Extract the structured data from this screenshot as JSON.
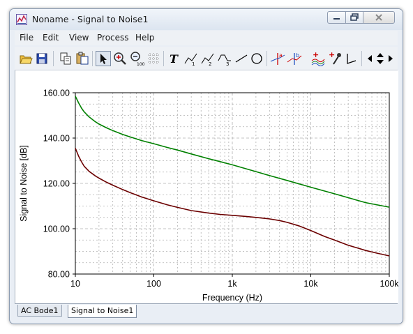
{
  "window": {
    "title": "Noname - Signal to Noise1"
  },
  "menu": [
    "File",
    "Edit",
    "View",
    "Process",
    "Help"
  ],
  "toolbar_icons": [
    "open-folder-icon",
    "save-icon",
    "copy-icon",
    "paste-icon",
    "pointer-icon",
    "zoom-in-icon",
    "zoom-out-100-icon",
    "grid-icon",
    "text-icon",
    "pen-1-icon",
    "pen-2-icon",
    "pen-3-icon",
    "line-icon",
    "circle-icon",
    "cursor-a-icon",
    "cursor-b-icon",
    "add-curve-icon",
    "add-marker-icon",
    "corner-icon",
    "scroll-left-icon",
    "scroll-updown-icon",
    "scroll-right-icon"
  ],
  "tabs": [
    "AC Bode1",
    "Signal to Noise1"
  ],
  "active_tab": 1,
  "colors": {
    "series1": "#008000",
    "series2": "#6b0000",
    "grid": "#b0b0b0"
  },
  "chart_data": {
    "type": "line",
    "xscale": "log",
    "xlabel": "Frequency (Hz)",
    "ylabel": "Signal to Noise [dB]",
    "xlim": [
      10,
      100000
    ],
    "ylim": [
      80,
      160
    ],
    "xticks": [
      10,
      100,
      1000,
      10000,
      100000
    ],
    "xtick_labels": [
      "10",
      "100",
      "1k",
      "10k",
      "100k"
    ],
    "yticks": [
      80,
      100,
      120,
      140,
      160
    ],
    "ytick_labels": [
      "80.00",
      "100.00",
      "120.00",
      "140.00",
      "160.00"
    ],
    "grid": true,
    "series": [
      {
        "color": "#008000",
        "x": [
          10,
          11,
          12,
          13,
          15,
          18,
          20,
          25,
          30,
          40,
          50,
          70,
          100,
          150,
          200,
          300,
          500,
          700,
          1000,
          2000,
          3000,
          5000,
          10000,
          20000,
          50000,
          100000
        ],
        "y": [
          158.5,
          155.5,
          153.2,
          151.5,
          149.3,
          147.2,
          146.2,
          144.5,
          143.3,
          141.6,
          140.5,
          138.9,
          137.5,
          135.8,
          134.7,
          133.0,
          130.9,
          129.6,
          128.2,
          125.2,
          123.4,
          121.3,
          118.3,
          115.4,
          111.5,
          109.5
        ]
      },
      {
        "color": "#6b0000",
        "x": [
          10,
          11,
          12,
          13,
          15,
          18,
          20,
          25,
          30,
          40,
          50,
          70,
          100,
          150,
          200,
          300,
          500,
          700,
          1000,
          1500,
          2000,
          3000,
          4000,
          5000,
          7000,
          10000,
          15000,
          20000,
          30000,
          50000,
          70000,
          100000
        ],
        "y": [
          135.5,
          132.0,
          129.5,
          127.5,
          125.3,
          123.3,
          122.3,
          120.5,
          119.2,
          117.3,
          115.9,
          114.0,
          112.3,
          110.5,
          109.4,
          108.0,
          106.9,
          106.3,
          105.9,
          105.4,
          105.0,
          104.3,
          103.6,
          102.8,
          101.3,
          99.2,
          96.6,
          95.0,
          92.7,
          90.4,
          89.2,
          88.0
        ]
      }
    ]
  }
}
